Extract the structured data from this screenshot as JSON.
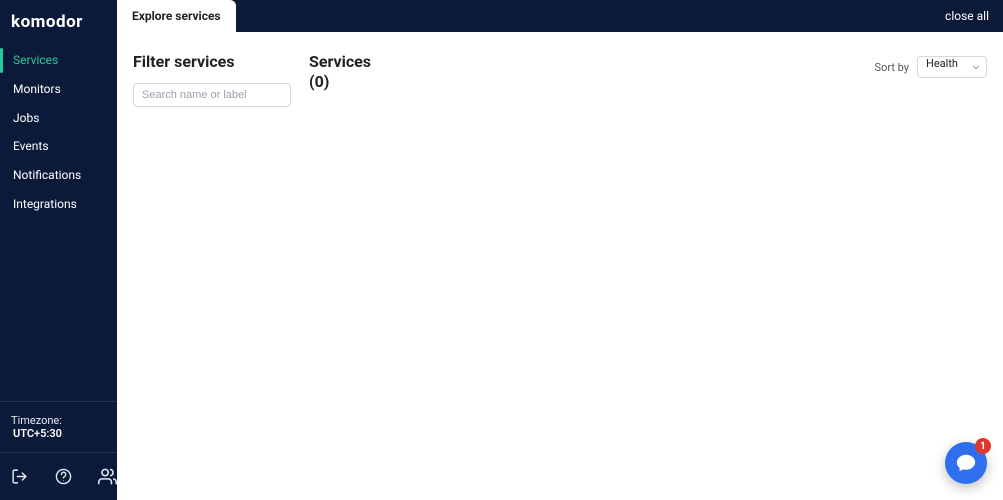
{
  "brand": {
    "name": "komodor"
  },
  "nav": {
    "items": [
      {
        "id": "services",
        "label": "Services",
        "active": true
      },
      {
        "id": "monitors",
        "label": "Monitors",
        "active": false
      },
      {
        "id": "jobs",
        "label": "Jobs",
        "active": false
      },
      {
        "id": "events",
        "label": "Events",
        "active": false
      },
      {
        "id": "notifications",
        "label": "Notifications",
        "active": false
      },
      {
        "id": "integrations",
        "label": "Integrations",
        "active": false
      }
    ]
  },
  "timezone": {
    "label": "Timezone:",
    "value": "UTC+5:30"
  },
  "tabs": {
    "active": "Explore services",
    "close_all_label": "close all"
  },
  "filter": {
    "title": "Filter services",
    "search_placeholder": "Search name or label"
  },
  "services": {
    "title": "Services",
    "count_display": "(0)",
    "count": 0
  },
  "sort": {
    "label": "Sort by",
    "selected": "Health"
  },
  "chat": {
    "badge_count": "1"
  }
}
